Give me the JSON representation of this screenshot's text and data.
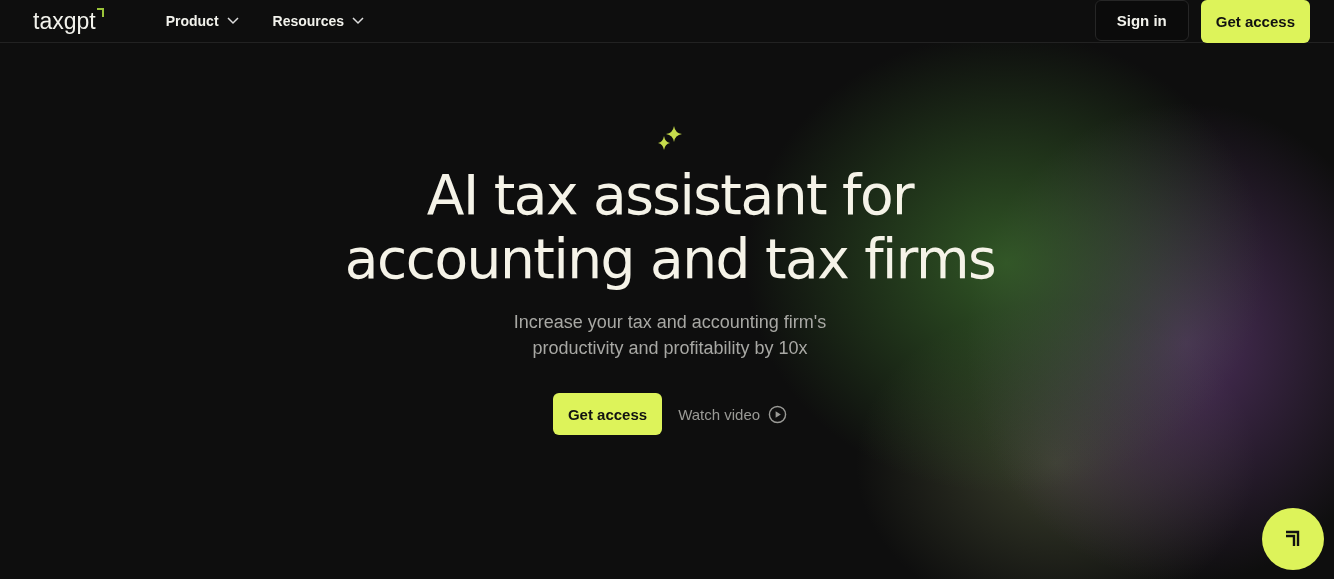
{
  "header": {
    "logo": "taxgpt",
    "nav": [
      {
        "label": "Product"
      },
      {
        "label": "Resources"
      }
    ],
    "sign_in": "Sign in",
    "get_access": "Get access"
  },
  "hero": {
    "title_lines": [
      "AI tax assistant for",
      "accounting and tax firms"
    ],
    "subtitle_lines": [
      "Increase your tax and accounting firm's",
      "productivity and profitability by 10x"
    ],
    "primary_button": "Get access",
    "secondary_link": "Watch video"
  }
}
